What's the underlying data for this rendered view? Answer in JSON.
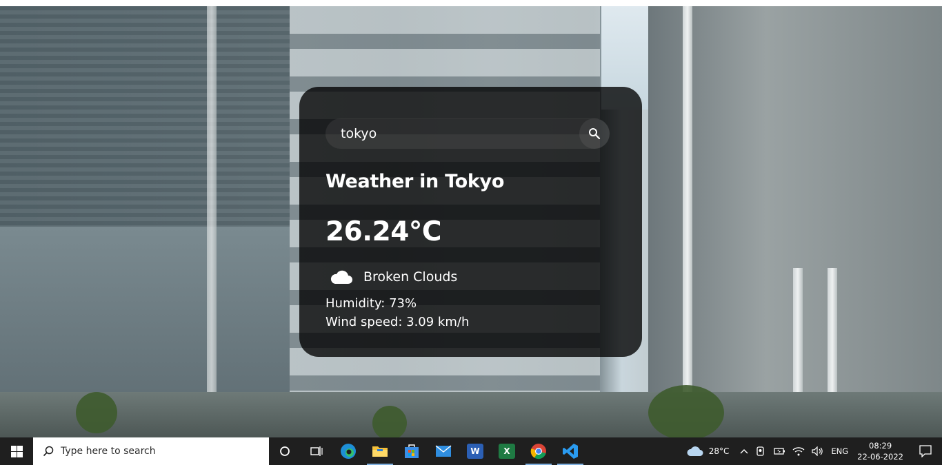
{
  "weather": {
    "search_value": "tokyo",
    "title": "Weather in Tokyo",
    "temperature": "26.24°C",
    "condition": "Broken Clouds",
    "condition_icon": "cloud-icon",
    "humidity": "Humidity: 73%",
    "wind": "Wind speed: 3.09 km/h"
  },
  "taskbar": {
    "search_placeholder": "Type here to search",
    "apps": [
      "task-view",
      "edge",
      "file-explorer",
      "microsoft-store",
      "mail",
      "word",
      "excel",
      "chrome",
      "vscode"
    ],
    "weather_temp": "28°C",
    "language": "ENG",
    "time": "08:29",
    "date": "22-06-2022"
  },
  "colors": {
    "card_bg": "rgba(0,0,0,0.78)",
    "taskbar_bg": "#1f1f1f",
    "text": "#ffffff"
  }
}
